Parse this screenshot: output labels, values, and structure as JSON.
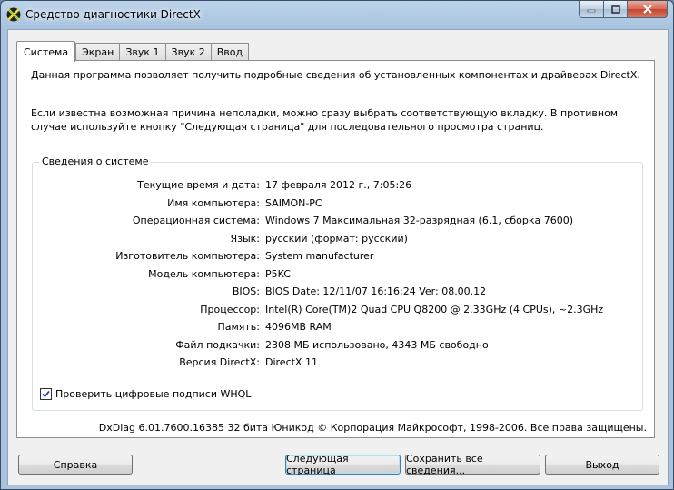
{
  "window": {
    "title": "Средство диагностики DirectX"
  },
  "tabs": [
    {
      "label": "Система",
      "active": true
    },
    {
      "label": "Экран",
      "active": false
    },
    {
      "label": "Звук 1",
      "active": false
    },
    {
      "label": "Звук 2",
      "active": false
    },
    {
      "label": "Ввод",
      "active": false
    }
  ],
  "intro": {
    "line1": "Данная программа позволяет получить подробные сведения об установленных компонентах и драйверах DirectX.",
    "line2": "Если известна возможная причина неполадки, можно сразу выбрать соответствующую вкладку. В противном случае используйте кнопку \"Следующая страница\" для последовательного просмотра страниц."
  },
  "system_info": {
    "legend": "Сведения о системе",
    "rows": [
      {
        "label": "Текущие время и дата:",
        "value": "17 февраля 2012 г., 7:05:26"
      },
      {
        "label": "Имя компьютера:",
        "value": "SAIMON-PC"
      },
      {
        "label": "Операционная система:",
        "value": "Windows 7 Максимальная 32-разрядная (6.1, сборка 7600)"
      },
      {
        "label": "Язык:",
        "value": "русский (формат: русский)"
      },
      {
        "label": "Изготовитель компьютера:",
        "value": "System manufacturer"
      },
      {
        "label": "Модель компьютера:",
        "value": "P5KC"
      },
      {
        "label": "BIOS:",
        "value": "BIOS Date: 12/11/07 16:16:24 Ver: 08.00.12"
      },
      {
        "label": "Процессор:",
        "value": "Intel(R) Core(TM)2 Quad  CPU   Q8200  @ 2.33GHz (4 CPUs), ~2.3GHz"
      },
      {
        "label": "Память:",
        "value": "4096MB RAM"
      },
      {
        "label": "Файл подкачки:",
        "value": "2308 МБ использовано, 4343 МБ свободно"
      },
      {
        "label": "Версия DirectX:",
        "value": "DirectX 11"
      }
    ]
  },
  "whql": {
    "label": "Проверить цифровые подписи WHQL",
    "checked": true
  },
  "footer": "DxDiag 6.01.7600.16385 32 бита Юникод  © Корпорация Майкрософт, 1998-2006.  Все права защищены.",
  "buttons": {
    "help": "Справка",
    "next": "Следующая страница",
    "save": "Сохранить все сведения...",
    "exit": "Выход"
  }
}
